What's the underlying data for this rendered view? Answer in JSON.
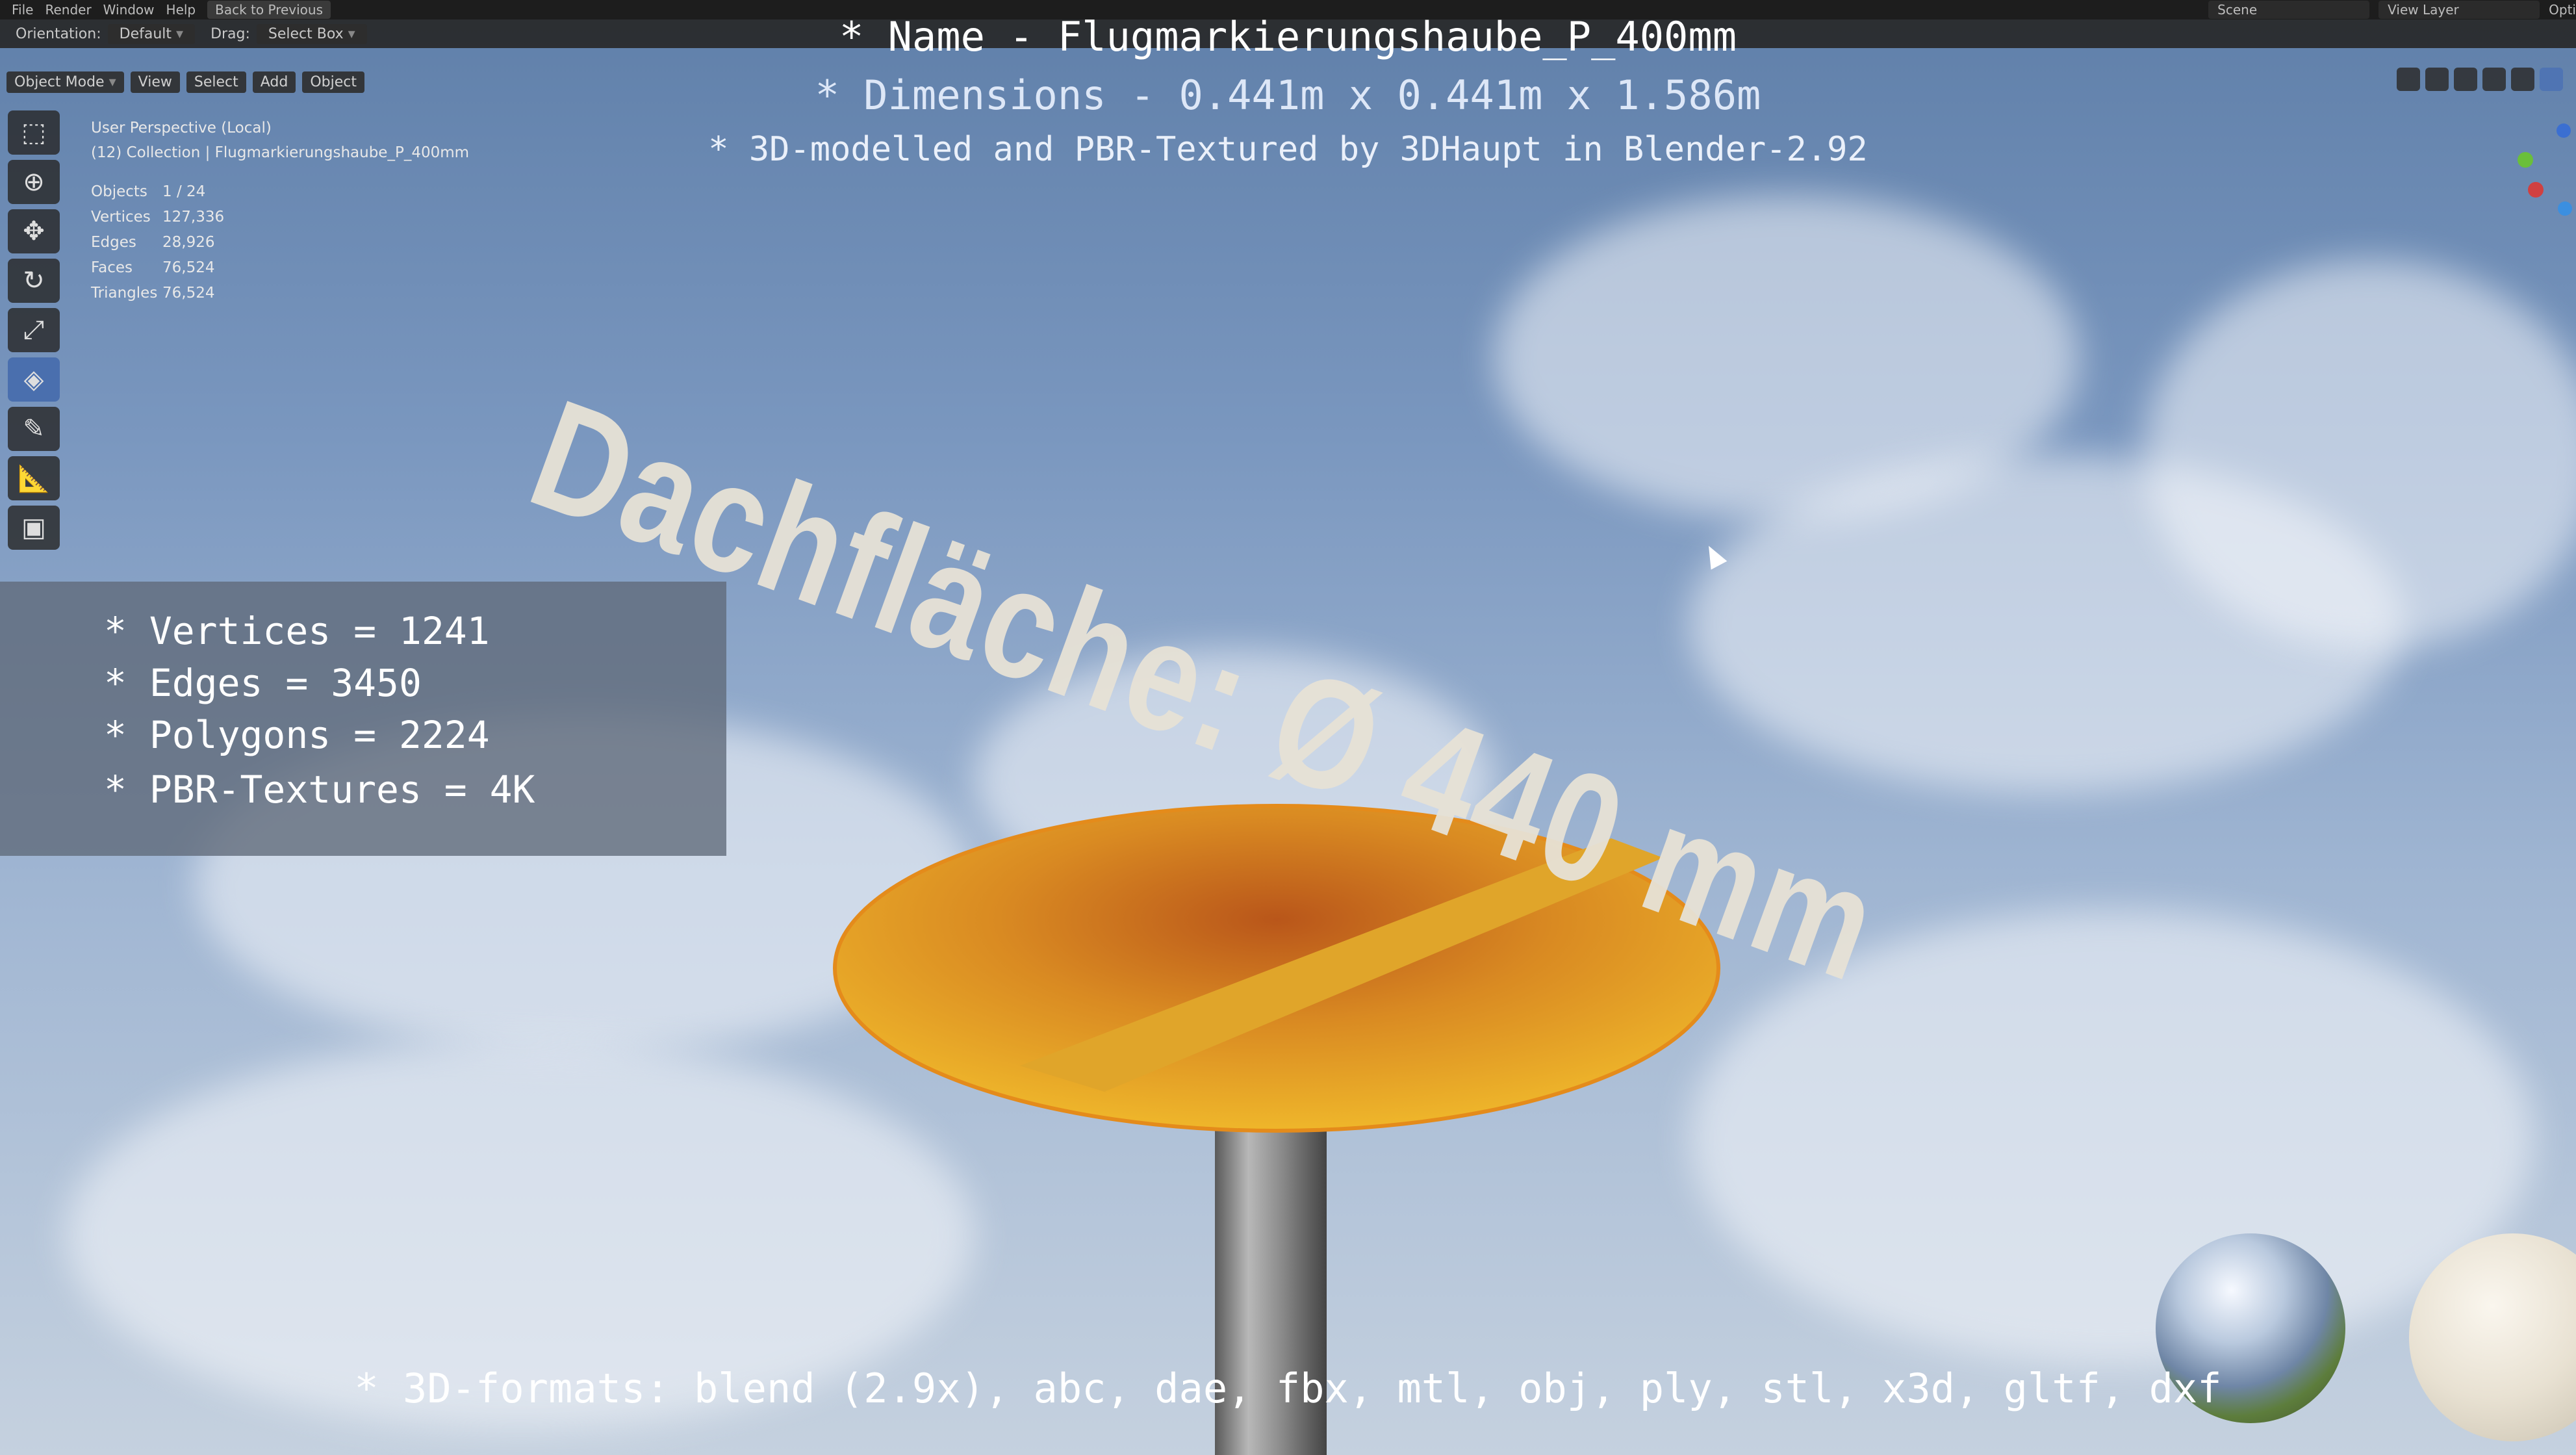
{
  "topbar": {
    "menu_items": [
      "File",
      "Render",
      "Window",
      "Help"
    ],
    "back_button": "Back to Previous",
    "scene_label": "Scene",
    "view_layer_label": "View Layer",
    "options_label": "Opti"
  },
  "tool_header": {
    "orientation_label": "Orientation:",
    "orientation_value": "Default",
    "drag_label": "Drag:",
    "drag_value": "Select Box"
  },
  "viewport_header": {
    "mode": "Object Mode",
    "menus": [
      "View",
      "Select",
      "Add",
      "Object"
    ]
  },
  "overlay": {
    "perspective": "User Perspective (Local)",
    "collection": "(12) Collection | Flugmarkierungshaube_P_400mm",
    "stats": [
      {
        "key": "Objects",
        "value": "1 / 24"
      },
      {
        "key": "Vertices",
        "value": "127,336"
      },
      {
        "key": "Edges",
        "value": "28,926"
      },
      {
        "key": "Faces",
        "value": "76,524"
      },
      {
        "key": "Triangles",
        "value": "76,524"
      }
    ]
  },
  "titles": {
    "name": "* Name - Flugmarkierungshaube_P_400mm",
    "dimensions": "* Dimensions -  0.441m x 0.441m x 1.586m",
    "credit": "* 3D-modelled and PBR-Textured by 3DHaupt in Blender-2.92"
  },
  "panel": {
    "lines": [
      "* Vertices = 1241",
      "* Edges = 3450",
      "* Polygons = 2224",
      "* PBR-Textures = 4K"
    ]
  },
  "scene_text": "Dachfläche:  Ø 440 mm",
  "formats": "* 3D-formats: blend (2.9x), abc, dae, fbx, mtl, obj, ply, stl, x3d, gltf, dxf",
  "colors": {
    "cap_yellow": "#f0b52a",
    "cap_shadow": "#c9781d",
    "pole": "#8d8d8d",
    "active_tool": "#4a6fae"
  }
}
